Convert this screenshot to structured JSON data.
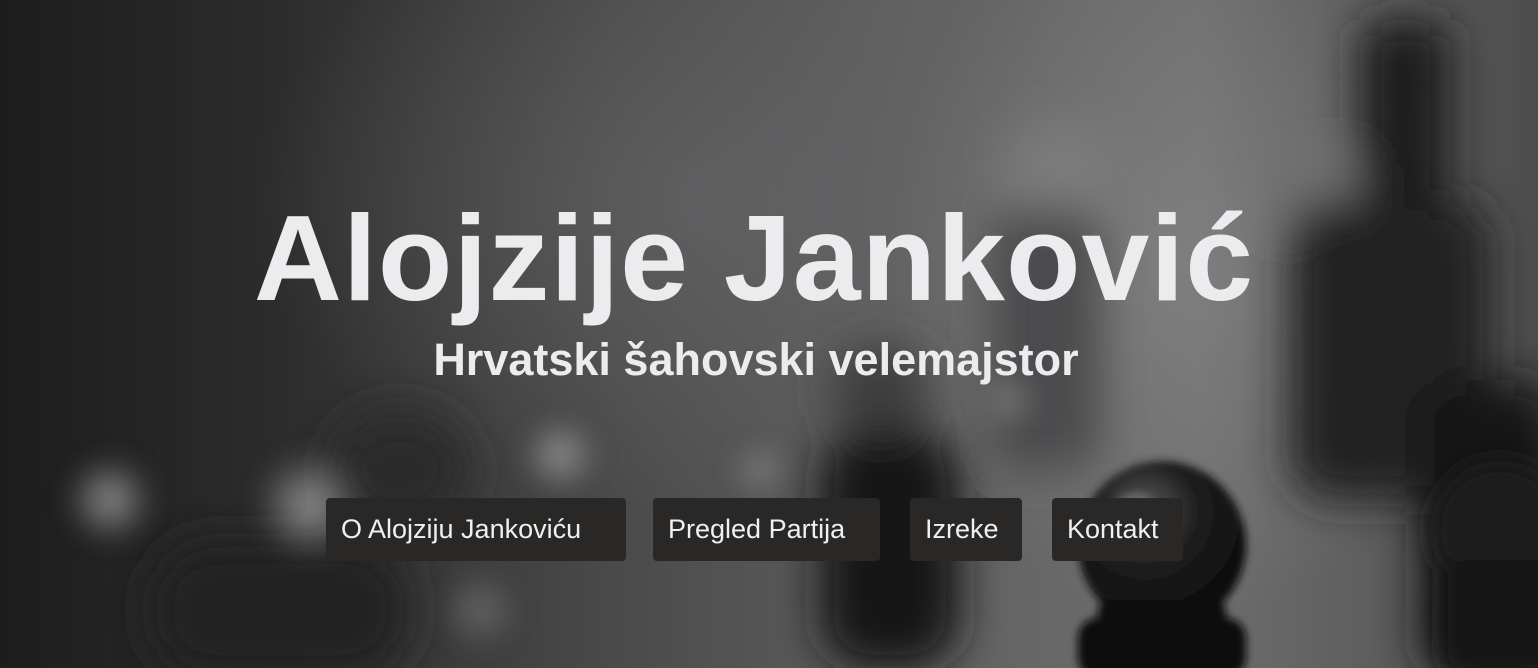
{
  "hero": {
    "title": "Alojzije Janković",
    "subtitle": "Hrvatski šahovski velemajstor",
    "background": "blurred-chess-pieces-photo"
  },
  "nav": {
    "items": [
      {
        "label": "O Alojziju Jankoviću"
      },
      {
        "label": "Pregled Partija"
      },
      {
        "label": "Izreke"
      },
      {
        "label": "Kontakt"
      }
    ]
  },
  "colors": {
    "text": "#ececee",
    "button_bg": "#2a2826",
    "button_text": "#f0f0f0"
  }
}
